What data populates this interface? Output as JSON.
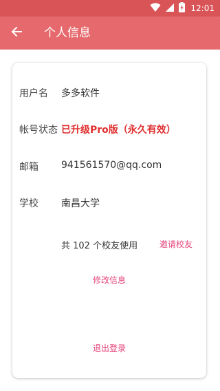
{
  "status_bar": {
    "time": "12:01",
    "icons": [
      "wifi-icon",
      "signal-icon",
      "battery-icon"
    ],
    "color": "#d95457"
  },
  "app_bar": {
    "title": "个人信息",
    "back_icon": "arrow-left-icon",
    "color": "#e66a6d"
  },
  "profile": {
    "username_label": "用户名",
    "username_value": "多多软件",
    "account_status_label": "帐号状态",
    "account_status_value": "已升级Pro版（永久有效）",
    "email_label": "邮箱",
    "email_value": "941561570@qq.com",
    "school_label": "学校",
    "school_value": "南昌大学",
    "alumni_count_text": "共 102 个校友使用",
    "invite_link": "邀请校友",
    "edit_link": "修改信息",
    "logout_link": "退出登录"
  },
  "colors": {
    "accent": "#e5437a",
    "status_red": "#e03030"
  }
}
